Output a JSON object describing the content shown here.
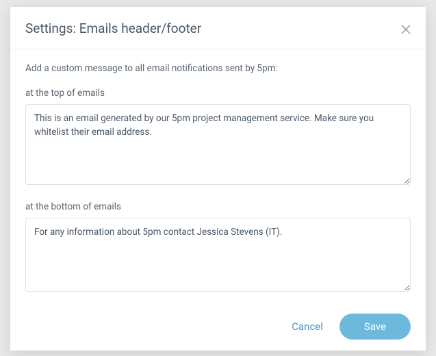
{
  "modal": {
    "title": "Settings: Emails header/footer",
    "intro": "Add a custom message to all email notifications sent by 5pm:",
    "topField": {
      "label": "at the top of emails",
      "value": "This is an email generated by our 5pm project management service. Make sure you whitelist their email address."
    },
    "bottomField": {
      "label": "at the bottom of emails",
      "value": "For any information about 5pm contact Jessica Stevens (IT)."
    },
    "actions": {
      "cancel": "Cancel",
      "save": "Save"
    }
  }
}
